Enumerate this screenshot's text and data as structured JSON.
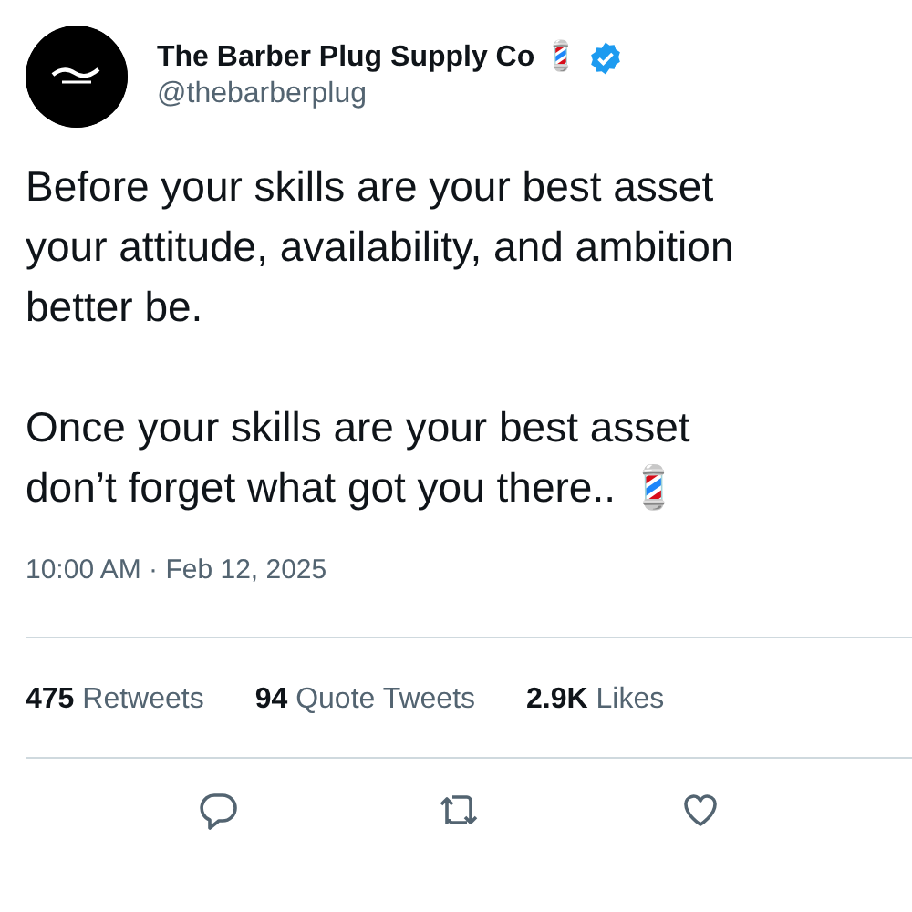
{
  "author": {
    "name": "The Barber Plug Supply Co 💈",
    "verified": true,
    "handle": "@thebarberplug"
  },
  "body": [
    "Before your skills are your best asset\nyour attitude, availability, and ambition\nbetter be.",
    "Once your skills are your best asset\ndon’t forget what got you there.. 💈"
  ],
  "timestamp": "10:00 AM · Feb 12, 2025",
  "stats": [
    {
      "count": "475",
      "label": "Retweets"
    },
    {
      "count": "94",
      "label": "Quote Tweets"
    },
    {
      "count": "2.9K",
      "label": "Likes"
    }
  ],
  "actions": [
    {
      "kind": "reply"
    },
    {
      "kind": "retweet"
    },
    {
      "kind": "like"
    }
  ]
}
